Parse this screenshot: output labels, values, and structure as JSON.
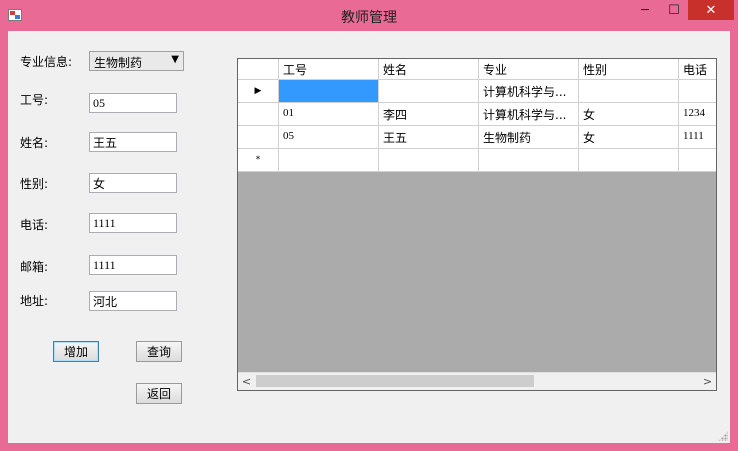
{
  "window": {
    "title": "教师管理",
    "min_glyph": "─",
    "max_glyph": "☐",
    "close_glyph": "✕"
  },
  "form": {
    "major_label": "专业信息:",
    "major_value": "生物制药",
    "id_label": "工号:",
    "id_value": "05",
    "name_label": "姓名:",
    "name_value": "王五",
    "gender_label": "性别:",
    "gender_value": "女",
    "phone_label": "电话:",
    "phone_value": "1111",
    "email_label": "邮箱:",
    "email_value": "1111",
    "address_label": "地址:",
    "address_value": "河北"
  },
  "buttons": {
    "add": "增加",
    "query": "查询",
    "back": "返回"
  },
  "grid": {
    "columns": [
      "工号",
      "姓名",
      "专业",
      "性别",
      "电话"
    ],
    "rows": [
      {
        "marker": "▶",
        "cells": [
          "",
          "",
          "计算机科学与...",
          "",
          ""
        ]
      },
      {
        "marker": "",
        "cells": [
          "01",
          "李四",
          "计算机科学与...",
          "女",
          "1234"
        ]
      },
      {
        "marker": "",
        "cells": [
          "05",
          "王五",
          "生物制药",
          "女",
          "1111"
        ]
      },
      {
        "marker": "*",
        "cells": [
          "",
          "",
          "",
          "",
          ""
        ]
      }
    ],
    "scroll_left": "<",
    "scroll_right": ">"
  }
}
